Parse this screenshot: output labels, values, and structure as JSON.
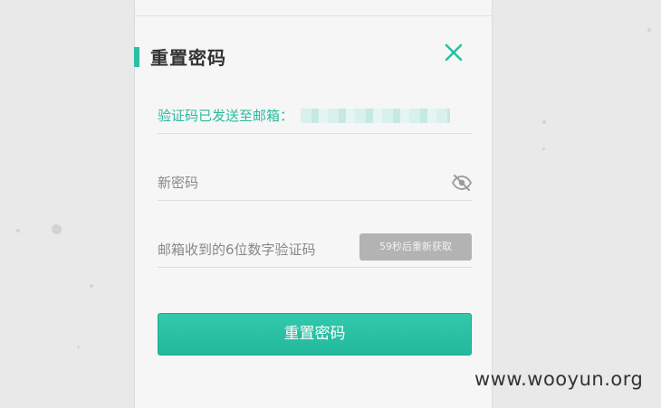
{
  "dialog": {
    "title": "重置密码",
    "close_icon": "close-icon",
    "email_notice_label": "验证码已发送至邮箱：",
    "new_password": {
      "placeholder": "新密码",
      "visibility_icon": "eye-slash-icon"
    },
    "code": {
      "placeholder": "邮箱收到的6位数字验证码",
      "resend_button_label": "59秒后重新获取"
    },
    "submit_label": "重置密码"
  },
  "watermark": "www.wooyun.org",
  "colors": {
    "accent": "#2bbfa3",
    "button_disabled": "#b3b3b3",
    "background": "#e9e9e9",
    "panel": "#f6f6f6"
  }
}
